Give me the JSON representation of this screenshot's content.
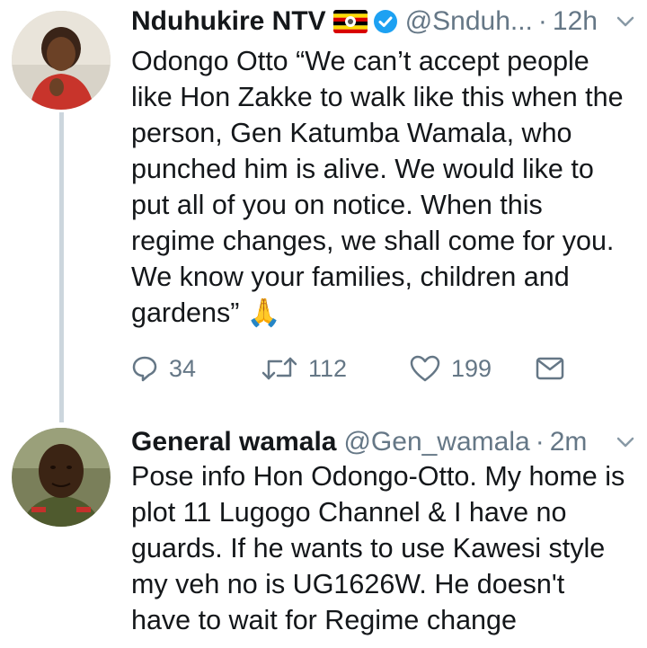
{
  "tweet1": {
    "name": "Nduhukire NTV",
    "handle": "@Snduh...",
    "sep": "·",
    "time": "12h",
    "text": "Odongo Otto “We can’t accept people like Hon Zakke to walk like this when the person, Gen Katumba Wamala, who punched him is alive. We would like to put all of you on notice. When this regime changes, we shall come for you. We know your families, children and gardens” 🙏",
    "reply_count": "34",
    "retweet_count": "112",
    "like_count": "199"
  },
  "tweet2": {
    "name": "General wamala",
    "handle": "@Gen_wamala",
    "sep": "·",
    "time": "2m",
    "text": "Pose info Hon Odongo-Otto. My home is plot 11 Lugogo Channel & I have no guards. If he wants to use Kawesi style my veh no is UG1626W. He doesn't have to wait for Regime change"
  },
  "colors": {
    "text": "#14171a",
    "secondary": "#657786",
    "thread_line": "#ccd6dd",
    "verified": "#1da1f2"
  },
  "icons": [
    "uganda-flag-icon",
    "verified-badge-icon",
    "chevron-down-icon",
    "reply-icon",
    "retweet-icon",
    "like-icon",
    "direct-message-icon"
  ]
}
